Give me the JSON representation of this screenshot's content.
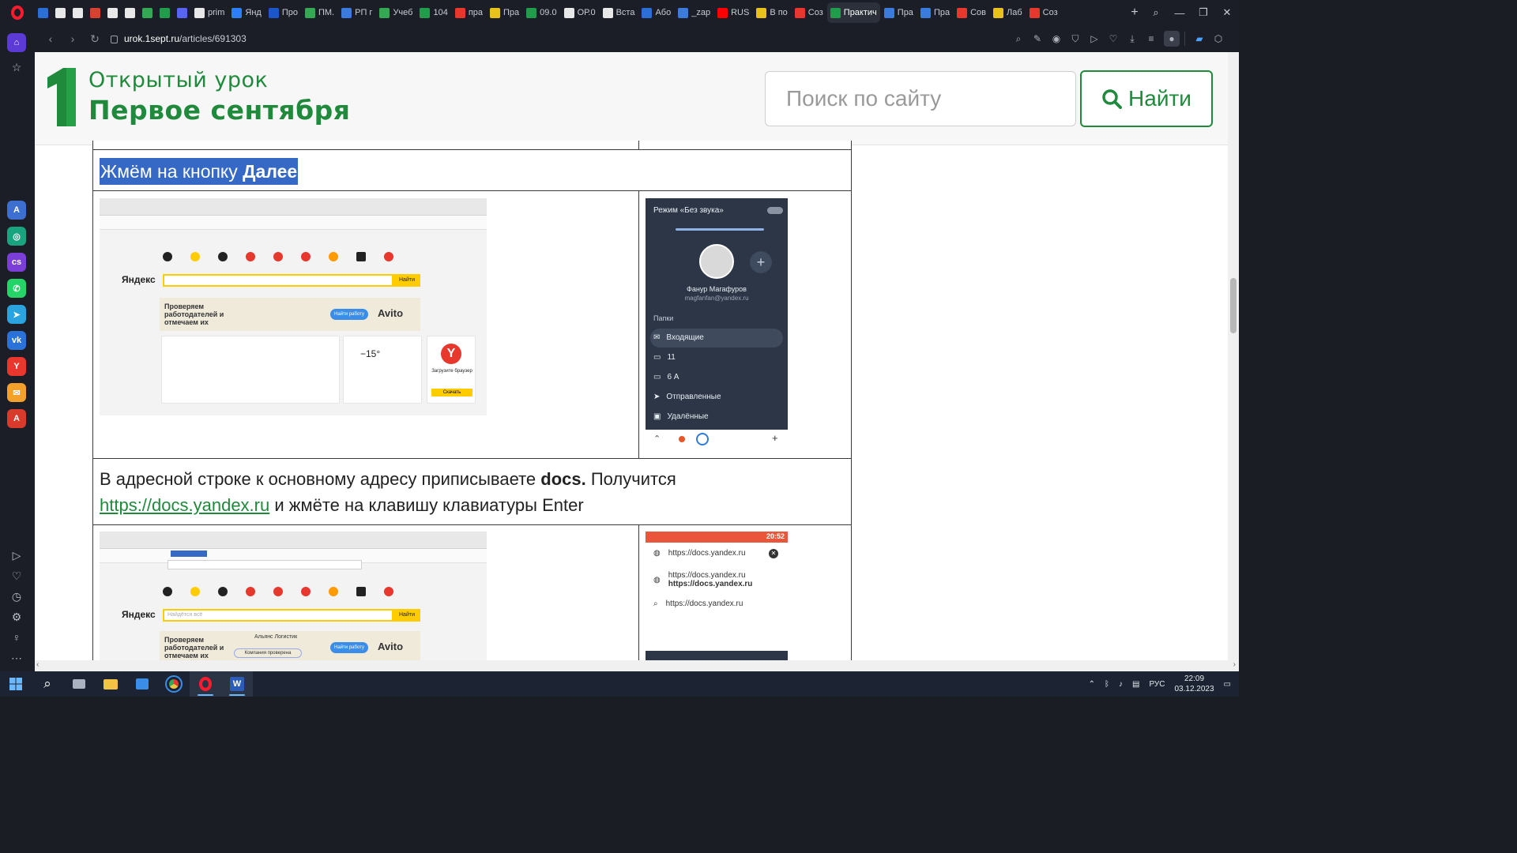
{
  "browser": {
    "tabs": [
      {
        "label": "",
        "color": "#2b6fd6"
      },
      {
        "label": "",
        "color": "#e8e8e8"
      },
      {
        "label": "",
        "color": "#e8e8e8"
      },
      {
        "label": "",
        "color": "#d9412f"
      },
      {
        "label": "",
        "color": "#e8e8e8"
      },
      {
        "label": "",
        "color": "#e8e8e8"
      },
      {
        "label": "",
        "color": "#34a853"
      },
      {
        "label": "",
        "color": "#1e9e4a"
      },
      {
        "label": "",
        "color": "#5865f2"
      },
      {
        "label": "prim",
        "color": "#e8e8e8"
      },
      {
        "label": "Янд",
        "color": "#2d7ef7"
      },
      {
        "label": "Про",
        "color": "#1b57c8"
      },
      {
        "label": "ПМ.",
        "color": "#34a853"
      },
      {
        "label": "РП г",
        "color": "#3b7bdc"
      },
      {
        "label": "Учеб",
        "color": "#34a853"
      },
      {
        "label": "104",
        "color": "#1e9e4a"
      },
      {
        "label": "пра",
        "color": "#e8372c"
      },
      {
        "label": "Пра",
        "color": "#e8c21b"
      },
      {
        "label": "09.0",
        "color": "#1e9e4a"
      },
      {
        "label": "ОР.0",
        "color": "#e8e8e8"
      },
      {
        "label": "Вста",
        "color": "#e8e8e8"
      },
      {
        "label": "Або",
        "color": "#2b6fd6"
      },
      {
        "label": "_zap",
        "color": "#3b7bdc"
      },
      {
        "label": "RUS",
        "color": "#ff0000"
      },
      {
        "label": "В по",
        "color": "#e8c21b"
      },
      {
        "label": "Соз",
        "color": "#e8372c"
      },
      {
        "label": "Практич",
        "color": "#1e9e4a"
      },
      {
        "label": "Пра",
        "color": "#3b7bdc"
      },
      {
        "label": "Пра",
        "color": "#3b7bdc"
      },
      {
        "label": "Сов",
        "color": "#e8372c"
      },
      {
        "label": "Лаб",
        "color": "#e8c21b"
      },
      {
        "label": "Соз",
        "color": "#e8372c"
      }
    ],
    "active_tab_index": 26,
    "url": {
      "domain": "urok.1sept.ru",
      "path": "/articles/691303"
    }
  },
  "site": {
    "logo_line1": "Открытый урок",
    "logo_line2": "Первое сентября",
    "search_placeholder": "Поиск по сайту",
    "search_button": "Найти",
    "brand_color": "#1f8a3b"
  },
  "article": {
    "step_highlight": {
      "text": "Жмём на кнопку ",
      "bold": "Далее"
    },
    "step2": {
      "text_before": "В адресной строке к основному адресу приписываете ",
      "bold": "docs.",
      "text_after": " Получится",
      "link": "https://docs.yandex.ru",
      "text_end": " и жмёте на клавишу клавиатуры Enter"
    },
    "shot1": {
      "logo": "Яндекс",
      "find_btn": "Найти",
      "banner": "Проверяем работодателей и отмечаем их",
      "banner_btn": "Найти работу",
      "avito": "Avito",
      "weather": "−15°",
      "browser_promo": "Загрузите браузер",
      "download_btn": "Скачать"
    },
    "shot2": {
      "logo": "Яндекс",
      "find_btn": "Найти",
      "banner": "Проверяем работодателей и отмечаем их",
      "company": "Альянс Логистик",
      "badge": "Компания проверена",
      "banner_btn": "Найти работу",
      "avito": "Avito",
      "placeholder": "Найдётся всё"
    },
    "phone1": {
      "mode": "Режим «Без звука»",
      "name": "Фанур Магафуров",
      "email": "magfanfan@yandex.ru",
      "section": "Папки",
      "folders": [
        "Входящие",
        "11",
        "6 А",
        "Отправленные",
        "Удалённые"
      ]
    },
    "phone2": {
      "time": "20:52",
      "rows": [
        "https://docs.yandex.ru",
        "https://docs.yandex.ru",
        "https://docs.yandex.ru",
        "https://docs.yandex.ru"
      ]
    }
  },
  "taskbar": {
    "language": "РУС",
    "time": "22:09",
    "date": "03.12.2023"
  }
}
